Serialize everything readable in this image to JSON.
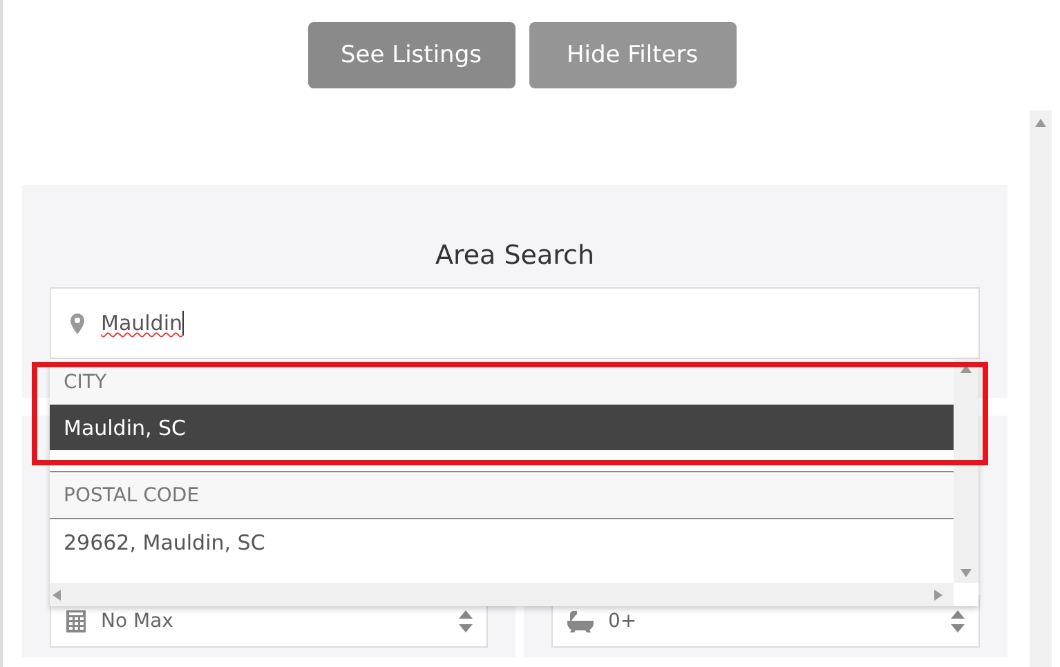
{
  "buttons": [
    {
      "label": "See Listings",
      "kind": "primary"
    },
    {
      "label": "Hide Filters",
      "kind": "secondary"
    }
  ],
  "area_search": {
    "title": "Area Search",
    "value": "Mauldin"
  },
  "suggestions": [
    {
      "heading": "CITY",
      "highlighted": true,
      "items": [
        {
          "label": "Mauldin, SC",
          "selected": true
        }
      ]
    },
    {
      "heading": "POSTAL CODE",
      "highlighted": false,
      "items": [
        {
          "label": "29662, Mauldin, SC",
          "selected": false
        }
      ]
    }
  ],
  "selects": [
    {
      "kind": "price",
      "value": "No Max"
    },
    {
      "kind": "baths",
      "value": "0+"
    }
  ]
}
